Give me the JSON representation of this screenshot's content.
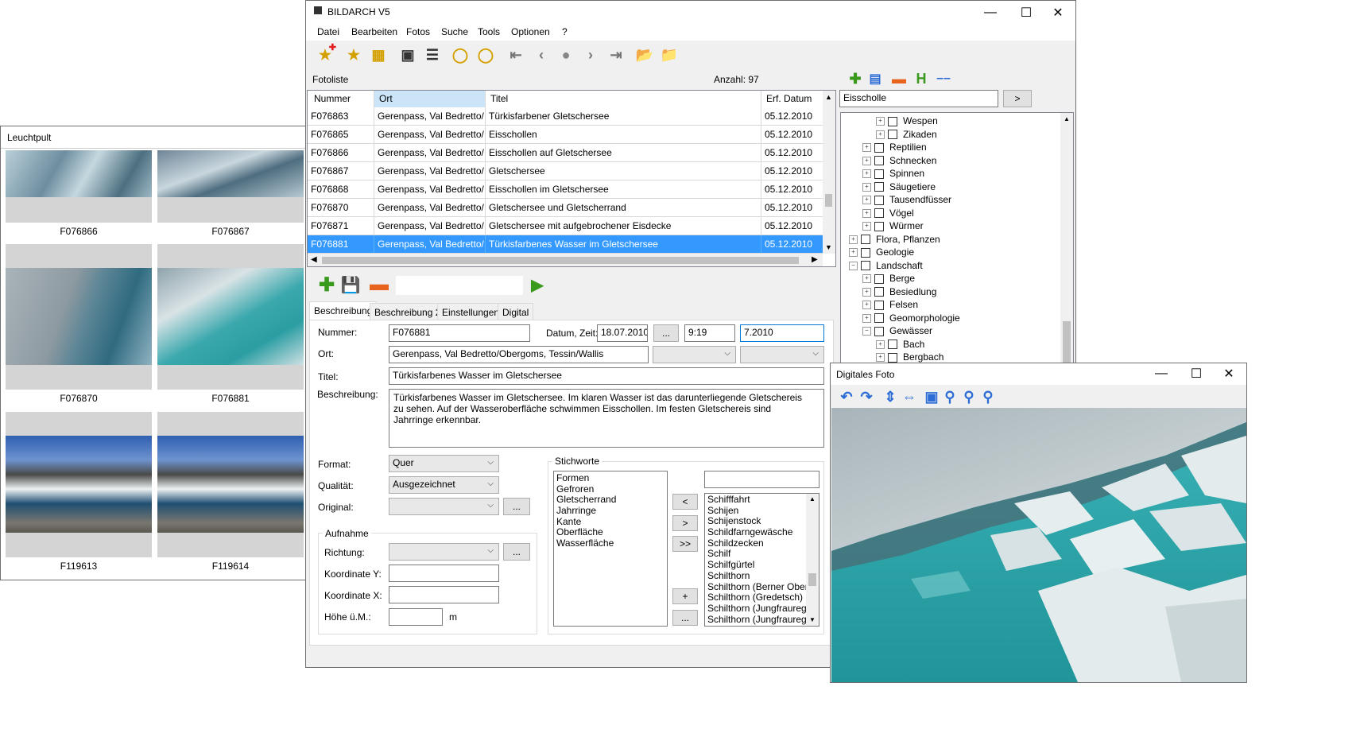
{
  "main": {
    "title": "BILDARCH V5",
    "menu": [
      "Datei",
      "Bearbeiten",
      "Fotos",
      "Suche",
      "Tools",
      "Optionen",
      "?"
    ],
    "fotoliste_label": "Fotoliste",
    "count_label": "Anzahl: 97",
    "columns": [
      "Nummer",
      "Ort",
      "Titel",
      "Erf. Datum"
    ],
    "rows": [
      [
        "F076863",
        "Gerenpass, Val Bedretto/...",
        "Türkisfarbener Gletschersee",
        "05.12.2010"
      ],
      [
        "F076865",
        "Gerenpass, Val Bedretto/...",
        "Eisschollen",
        "05.12.2010"
      ],
      [
        "F076866",
        "Gerenpass, Val Bedretto/...",
        "Eisschollen auf Gletschersee",
        "05.12.2010"
      ],
      [
        "F076867",
        "Gerenpass, Val Bedretto/...",
        "Gletschersee",
        "05.12.2010"
      ],
      [
        "F076868",
        "Gerenpass, Val Bedretto/...",
        "Eisschollen im Gletschersee",
        "05.12.2010"
      ],
      [
        "F076870",
        "Gerenpass, Val Bedretto/...",
        "Gletschersee und Gletscherrand",
        "05.12.2010"
      ],
      [
        "F076871",
        "Gerenpass, Val Bedretto/...",
        "Gletschersee mit aufgebrochener Eisdecke",
        "05.12.2010"
      ],
      [
        "F076881",
        "Gerenpass, Val Bedretto/...",
        "Türkisfarbenes Wasser im Gletschersee",
        "05.12.2010"
      ]
    ],
    "tabs": [
      "Beschreibung",
      "Beschreibung 2",
      "Einstellungen",
      "Digital"
    ],
    "form": {
      "nummer_label": "Nummer:",
      "nummer": "F076881",
      "datum_label": "Datum, Zeit:",
      "datum": "18.07.2010",
      "zeit": "9:19",
      "datum2": "7.2010",
      "dots": "...",
      "ort_label": "Ort:",
      "ort": "Gerenpass, Val Bedretto/Obergoms, Tessin/Wallis",
      "titel_label": "Titel:",
      "titel": "Türkisfarbenes Wasser im Gletschersee",
      "beschreibung_label": "Beschreibung:",
      "beschreibung": "Türkisfarbenes Wasser im Gletschersee. Im klaren Wasser ist das darunterliegende Gletschereis zu sehen. Auf der Wasseroberfläche schwimmen Eisschollen. Im festen Gletschereis sind Jahrringe erkennbar.",
      "format_label": "Format:",
      "format": "Quer",
      "qualitaet_label": "Qualität:",
      "qualitaet": "Ausgezeichnet",
      "original_label": "Original:",
      "aufnahme_label": "Aufnahme",
      "richtung_label": "Richtung:",
      "koord_y_label": "Koordinate Y:",
      "koord_x_label": "Koordinate X:",
      "hoehe_label": "Höhe ü.M.:",
      "hoehe_unit": "m",
      "stichworte_label": "Stichworte",
      "stichworte": [
        "Formen",
        "Gefroren",
        "Gletscherrand",
        "Jahrringe",
        "Kante",
        "Oberfläche",
        "Wasserfläche"
      ],
      "keyword_list": [
        "Schifffahrt",
        "Schijen",
        "Schijenstock",
        "Schildfarngewäsche",
        "Schildzecken",
        "Schilf",
        "Schilfgürtel",
        "Schilthorn",
        "Schilthorn (Berner Oberla",
        "Schilthorn (Gredetsch)",
        "Schilthorn (Jungfrauregio",
        "Schilthorn (Jungfrauregio"
      ],
      "btn_left": "<",
      "btn_right": ">",
      "btn_all": ">>",
      "btn_plus": "+",
      "btn_dots": "..."
    },
    "tree": {
      "search_value": "Eisscholle",
      "go_label": ">",
      "items": [
        {
          "label": "Wespen",
          "indent": 3
        },
        {
          "label": "Zikaden",
          "indent": 3
        },
        {
          "label": "Reptilien",
          "indent": 2
        },
        {
          "label": "Schnecken",
          "indent": 2
        },
        {
          "label": "Spinnen",
          "indent": 2
        },
        {
          "label": "Säugetiere",
          "indent": 2
        },
        {
          "label": "Tausendfüsser",
          "indent": 2
        },
        {
          "label": "Vögel",
          "indent": 2
        },
        {
          "label": "Würmer",
          "indent": 2
        },
        {
          "label": "Flora, Pflanzen",
          "indent": 1
        },
        {
          "label": "Geologie",
          "indent": 1
        },
        {
          "label": "Landschaft",
          "indent": 1
        },
        {
          "label": "Berge",
          "indent": 2
        },
        {
          "label": "Besiedlung",
          "indent": 2
        },
        {
          "label": "Felsen",
          "indent": 2
        },
        {
          "label": "Geomorphologie",
          "indent": 2
        },
        {
          "label": "Gewässer",
          "indent": 2
        },
        {
          "label": "Bach",
          "indent": 3
        },
        {
          "label": "Bergbach",
          "indent": 3
        }
      ]
    }
  },
  "leuchtpult": {
    "title": "Leuchtpult",
    "thumbs": [
      "F076866",
      "F076867",
      "F076870",
      "F076881",
      "F119613",
      "F119614"
    ]
  },
  "digital": {
    "title": "Digitales Foto"
  },
  "colors": {
    "selection": "#3399ff",
    "header_selected": "#cce4f7",
    "green": "#3a9a1e",
    "orange": "#e8641e",
    "icon_blue": "#2b6cd6"
  }
}
